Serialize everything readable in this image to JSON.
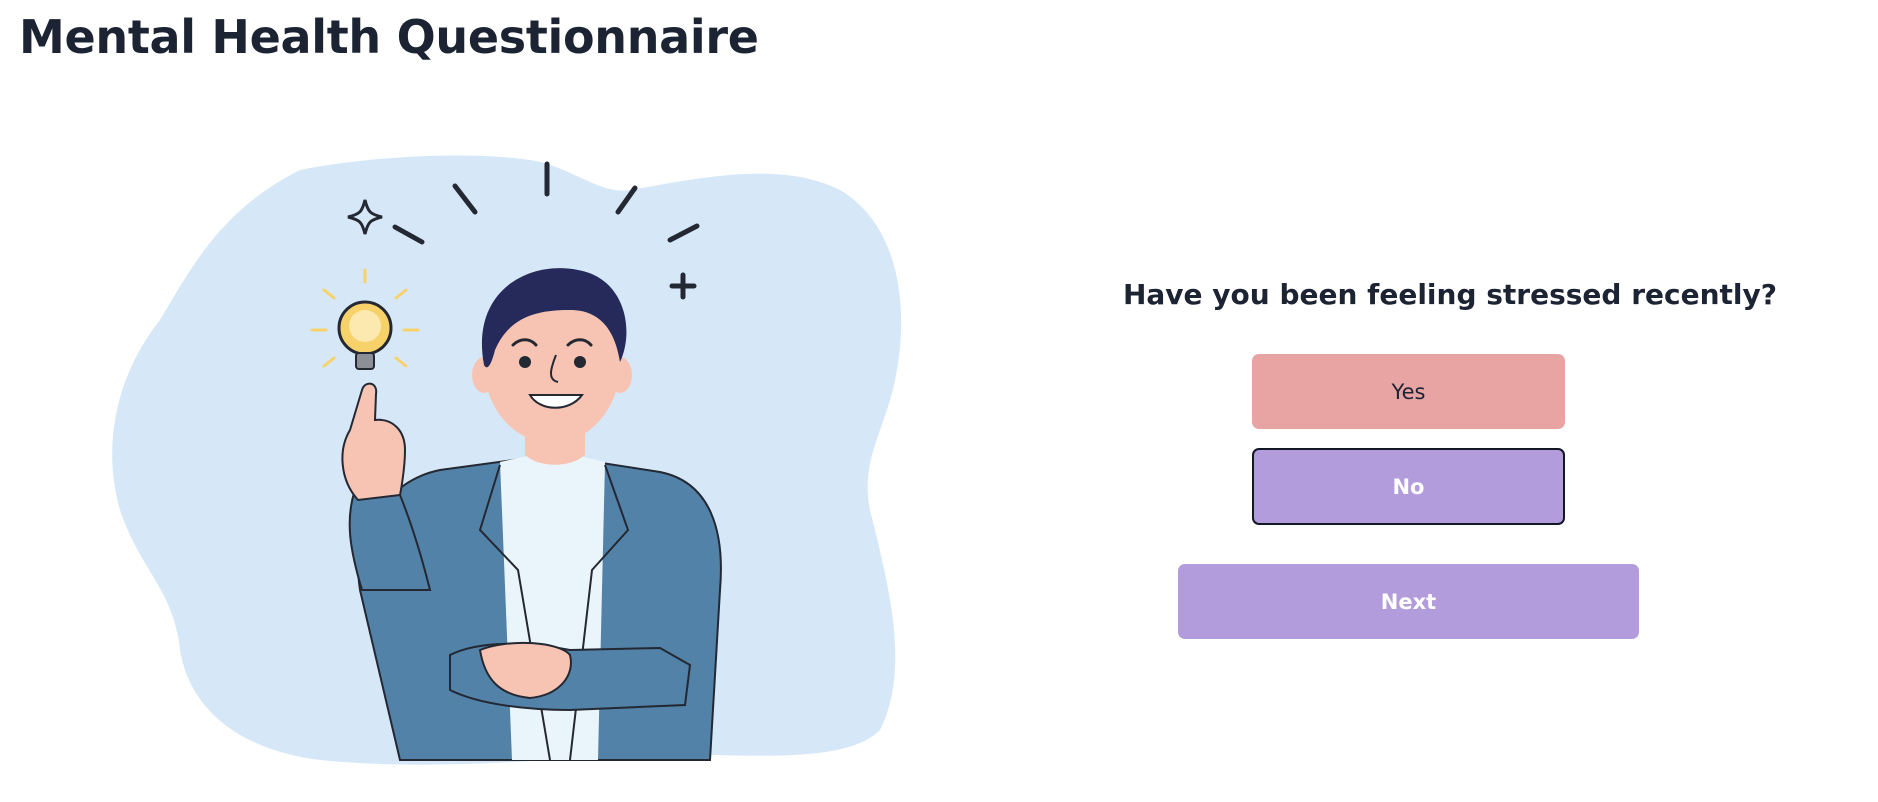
{
  "page": {
    "title": "Mental Health Questionnaire"
  },
  "illustration": {
    "icon": "thinking-man-lightbulb-illustration",
    "colors": {
      "blob": "#d6e8f8",
      "jacket": "#5282a8",
      "hair": "#262a5a",
      "skin": "#f7c4b3",
      "bulb": "#f7d26a"
    }
  },
  "question": {
    "text": "Have you been feeling stressed recently?",
    "options": {
      "yes_label": "Yes",
      "no_label": "No"
    },
    "next_label": "Next"
  },
  "colors": {
    "yes_button": "#e8a4a3",
    "no_button": "#b29cdb",
    "next_button": "#b29cdb",
    "text": "#1c2433"
  }
}
